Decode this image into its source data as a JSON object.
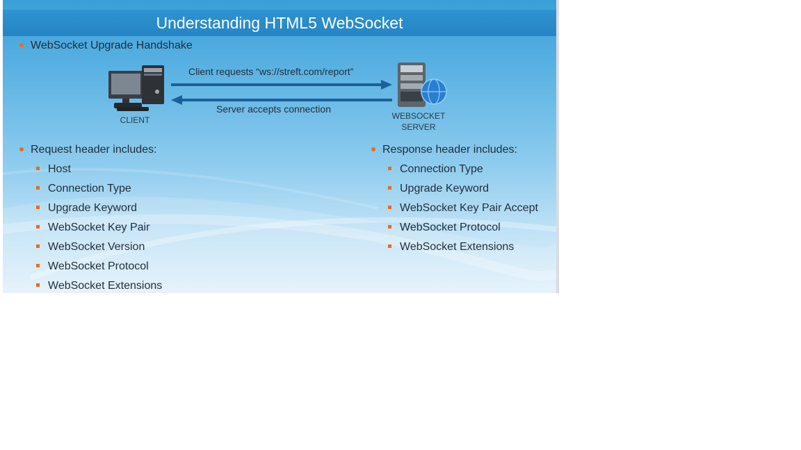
{
  "slide": {
    "title": "Understanding HTML5 WebSocket",
    "intro_bullet": "WebSocket Upgrade Handshake",
    "diagram": {
      "client_label": "CLIENT",
      "server_label_line1": "WEBSOCKET",
      "server_label_line2": "SERVER",
      "request_label": "Client requests “ws://streft.com/report”",
      "response_label": "Server accepts connection"
    },
    "request_header": {
      "heading": "Request header includes:",
      "items": [
        "Host",
        "Connection Type",
        "Upgrade Keyword",
        "WebSocket Key Pair",
        "WebSocket Version",
        "WebSocket Protocol",
        "WebSocket Extensions"
      ]
    },
    "response_header": {
      "heading": "Response header includes:",
      "items": [
        "Connection Type",
        "Upgrade Keyword",
        "WebSocket Key Pair Accept",
        "WebSocket Protocol",
        "WebSocket Extensions"
      ]
    },
    "colors": {
      "title_band": "#2585c4",
      "bullet_accent": "#ee6a1c",
      "arrow": "#1a5f9a"
    }
  }
}
